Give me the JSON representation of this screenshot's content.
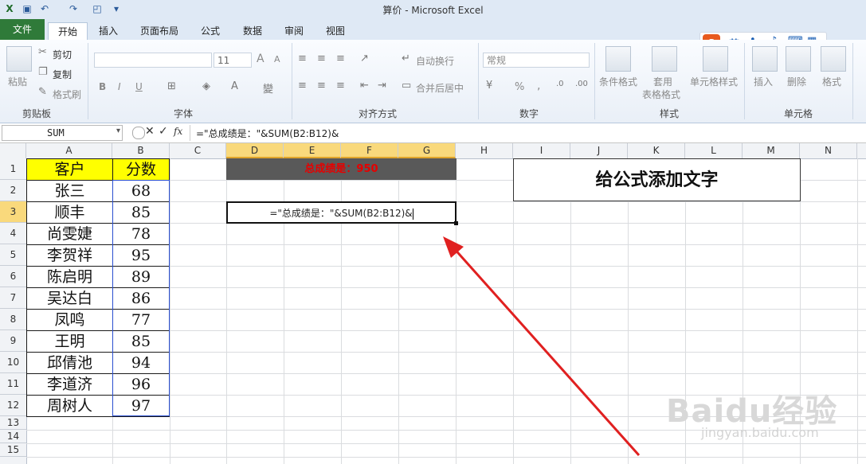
{
  "window": {
    "title": "算价 - Microsoft Excel"
  },
  "tabs": [
    "文件",
    "开始",
    "插入",
    "页面布局",
    "公式",
    "数据",
    "审阅",
    "视图"
  ],
  "ribbon": {
    "clipboard": {
      "paste": "粘贴",
      "cut": "剪切",
      "copy": "复制",
      "format_painter": "格式刷",
      "group": "剪贴板"
    },
    "font": {
      "size": "11",
      "bold": "B",
      "italic": "I",
      "underline": "U",
      "grow": "A",
      "shrink": "A",
      "group": "字体"
    },
    "alignment": {
      "wrap": "自动换行",
      "merge": "合并后居中",
      "group": "对齐方式"
    },
    "number": {
      "format": "常规",
      "percent": "%",
      "comma": ",",
      "group": "数字"
    },
    "styles": {
      "cond": "条件格式",
      "table1": "套用",
      "table2": "表格格式",
      "cell_styles": "单元格样式",
      "group": "样式"
    },
    "cells": {
      "insert": "插入",
      "delete": "删除",
      "format": "格式",
      "group": "单元格"
    },
    "ime": {
      "lang": "英"
    }
  },
  "formula_bar": {
    "name_box": "SUM",
    "fx": "fx",
    "formula": "=\"总成绩是：\"&SUM(B2:B12)&"
  },
  "columns": [
    "A",
    "B",
    "C",
    "D",
    "E",
    "F",
    "G",
    "H",
    "I",
    "J",
    "K",
    "L",
    "M",
    "N"
  ],
  "rows": [
    "1",
    "2",
    "3",
    "4",
    "5",
    "6",
    "7",
    "8",
    "9",
    "10",
    "11",
    "12",
    "13",
    "14",
    "15"
  ],
  "table": {
    "header": {
      "customer": "客户",
      "score": "分数"
    },
    "names": [
      "张三",
      "顺丰",
      "尚雯婕",
      "李贺祥",
      "陈启明",
      "吴达白",
      "凤鸣",
      "王明",
      "邱倩池",
      "李道济",
      "周树人"
    ],
    "scores": [
      "68",
      "85",
      "78",
      "95",
      "89",
      "86",
      "77",
      "85",
      "94",
      "96",
      "97"
    ]
  },
  "merged_d1": "总成绩是：950",
  "edit_cell_d3": "=\"总成绩是：\"&SUM(B2:B12)&",
  "i1_title": "给公式添加文字",
  "watermark": {
    "brand": "Baidu经验",
    "url": "jingyan.baidu.com"
  },
  "colors": {
    "accent_file": "#2f7a39",
    "header_yellow": "#ffff00",
    "dark_fill": "#595959",
    "red_text": "#e60000",
    "arrow": "#e02020"
  }
}
